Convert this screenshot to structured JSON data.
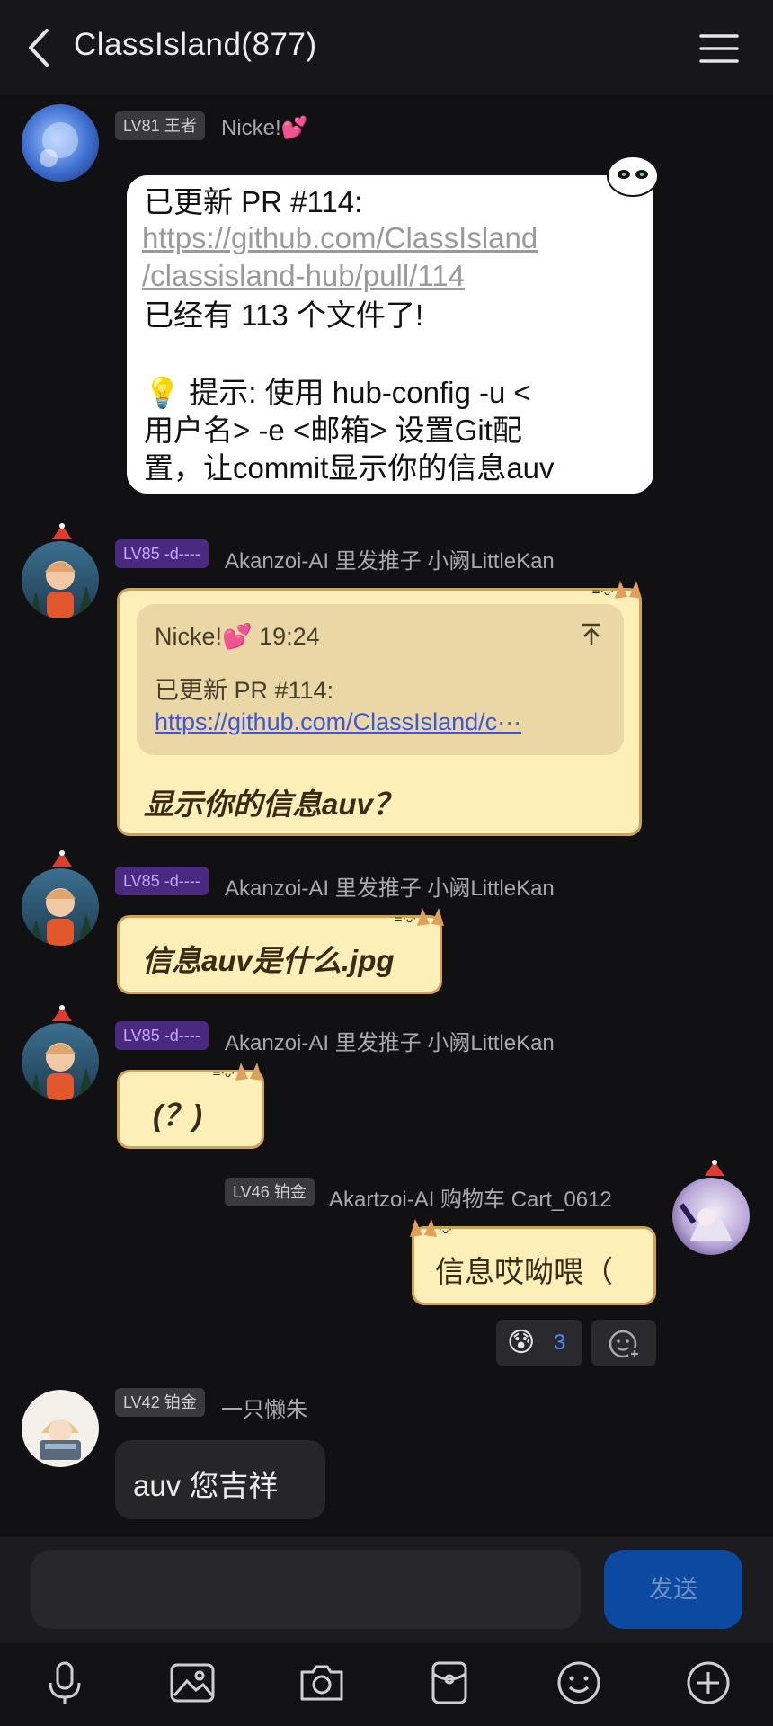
{
  "header": {
    "title": "ClassIsland(877)"
  },
  "messages": [
    {
      "level": "LV81 王者",
      "name": "Nicke!💕",
      "lines": [
        "已更新 PR #114:",
        "已经有 113 个文件了!",
        "💡 提示: 使用 hub-config -u <",
        "用户名> -e <邮箱> 设置Git配",
        "置，让commit显示你的信息auv"
      ],
      "link_lines": [
        "https://github.com/ClassIsland",
        "/classisland-hub/pull/114"
      ]
    },
    {
      "level": "LV85 -d----",
      "name": "Akanzoi-AI 里发推子 小阙LittleKan",
      "quote": {
        "author": "Nicke!💕 19:24",
        "text": "已更新 PR #114:",
        "link": "https://github.com/ClassIsland/c···"
      },
      "text": "显示你的信息auv？"
    },
    {
      "level": "LV85 -d----",
      "name": "Akanzoi-AI 里发推子 小阙LittleKan",
      "text": "信息auv是什么.jpg"
    },
    {
      "level": "LV85 -d----",
      "name": "Akanzoi-AI 里发推子 小阙LittleKan",
      "text": "(？)"
    },
    {
      "level": "LV46 铂金",
      "name": "Akartzoi-AI 购物车 Cart_0612",
      "text": "信息哎呦喂（",
      "reaction": {
        "emoji": "😰",
        "count": "3"
      }
    },
    {
      "level": "LV42 铂金",
      "name": "一只懒朱",
      "text": "auv 您吉祥"
    }
  ],
  "composer": {
    "send_label": "发送"
  },
  "colors": {
    "accent": "#0b4aa0",
    "bubble_cream": "#fcefb8",
    "badge_purple": "#4a2a80"
  }
}
